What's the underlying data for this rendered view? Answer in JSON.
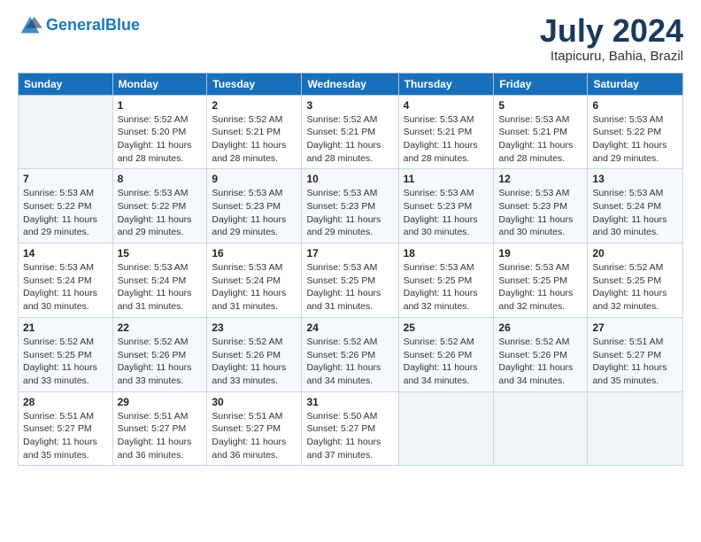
{
  "header": {
    "logo_line1": "General",
    "logo_line2": "Blue",
    "month": "July 2024",
    "location": "Itapicuru, Bahia, Brazil"
  },
  "weekdays": [
    "Sunday",
    "Monday",
    "Tuesday",
    "Wednesday",
    "Thursday",
    "Friday",
    "Saturday"
  ],
  "weeks": [
    [
      {
        "day": "",
        "info": ""
      },
      {
        "day": "1",
        "info": "Sunrise: 5:52 AM\nSunset: 5:20 PM\nDaylight: 11 hours\nand 28 minutes."
      },
      {
        "day": "2",
        "info": "Sunrise: 5:52 AM\nSunset: 5:21 PM\nDaylight: 11 hours\nand 28 minutes."
      },
      {
        "day": "3",
        "info": "Sunrise: 5:52 AM\nSunset: 5:21 PM\nDaylight: 11 hours\nand 28 minutes."
      },
      {
        "day": "4",
        "info": "Sunrise: 5:53 AM\nSunset: 5:21 PM\nDaylight: 11 hours\nand 28 minutes."
      },
      {
        "day": "5",
        "info": "Sunrise: 5:53 AM\nSunset: 5:21 PM\nDaylight: 11 hours\nand 28 minutes."
      },
      {
        "day": "6",
        "info": "Sunrise: 5:53 AM\nSunset: 5:22 PM\nDaylight: 11 hours\nand 29 minutes."
      }
    ],
    [
      {
        "day": "7",
        "info": "Sunrise: 5:53 AM\nSunset: 5:22 PM\nDaylight: 11 hours\nand 29 minutes."
      },
      {
        "day": "8",
        "info": "Sunrise: 5:53 AM\nSunset: 5:22 PM\nDaylight: 11 hours\nand 29 minutes."
      },
      {
        "day": "9",
        "info": "Sunrise: 5:53 AM\nSunset: 5:23 PM\nDaylight: 11 hours\nand 29 minutes."
      },
      {
        "day": "10",
        "info": "Sunrise: 5:53 AM\nSunset: 5:23 PM\nDaylight: 11 hours\nand 29 minutes."
      },
      {
        "day": "11",
        "info": "Sunrise: 5:53 AM\nSunset: 5:23 PM\nDaylight: 11 hours\nand 30 minutes."
      },
      {
        "day": "12",
        "info": "Sunrise: 5:53 AM\nSunset: 5:23 PM\nDaylight: 11 hours\nand 30 minutes."
      },
      {
        "day": "13",
        "info": "Sunrise: 5:53 AM\nSunset: 5:24 PM\nDaylight: 11 hours\nand 30 minutes."
      }
    ],
    [
      {
        "day": "14",
        "info": "Sunrise: 5:53 AM\nSunset: 5:24 PM\nDaylight: 11 hours\nand 30 minutes."
      },
      {
        "day": "15",
        "info": "Sunrise: 5:53 AM\nSunset: 5:24 PM\nDaylight: 11 hours\nand 31 minutes."
      },
      {
        "day": "16",
        "info": "Sunrise: 5:53 AM\nSunset: 5:24 PM\nDaylight: 11 hours\nand 31 minutes."
      },
      {
        "day": "17",
        "info": "Sunrise: 5:53 AM\nSunset: 5:25 PM\nDaylight: 11 hours\nand 31 minutes."
      },
      {
        "day": "18",
        "info": "Sunrise: 5:53 AM\nSunset: 5:25 PM\nDaylight: 11 hours\nand 32 minutes."
      },
      {
        "day": "19",
        "info": "Sunrise: 5:53 AM\nSunset: 5:25 PM\nDaylight: 11 hours\nand 32 minutes."
      },
      {
        "day": "20",
        "info": "Sunrise: 5:52 AM\nSunset: 5:25 PM\nDaylight: 11 hours\nand 32 minutes."
      }
    ],
    [
      {
        "day": "21",
        "info": "Sunrise: 5:52 AM\nSunset: 5:25 PM\nDaylight: 11 hours\nand 33 minutes."
      },
      {
        "day": "22",
        "info": "Sunrise: 5:52 AM\nSunset: 5:26 PM\nDaylight: 11 hours\nand 33 minutes."
      },
      {
        "day": "23",
        "info": "Sunrise: 5:52 AM\nSunset: 5:26 PM\nDaylight: 11 hours\nand 33 minutes."
      },
      {
        "day": "24",
        "info": "Sunrise: 5:52 AM\nSunset: 5:26 PM\nDaylight: 11 hours\nand 34 minutes."
      },
      {
        "day": "25",
        "info": "Sunrise: 5:52 AM\nSunset: 5:26 PM\nDaylight: 11 hours\nand 34 minutes."
      },
      {
        "day": "26",
        "info": "Sunrise: 5:52 AM\nSunset: 5:26 PM\nDaylight: 11 hours\nand 34 minutes."
      },
      {
        "day": "27",
        "info": "Sunrise: 5:51 AM\nSunset: 5:27 PM\nDaylight: 11 hours\nand 35 minutes."
      }
    ],
    [
      {
        "day": "28",
        "info": "Sunrise: 5:51 AM\nSunset: 5:27 PM\nDaylight: 11 hours\nand 35 minutes."
      },
      {
        "day": "29",
        "info": "Sunrise: 5:51 AM\nSunset: 5:27 PM\nDaylight: 11 hours\nand 36 minutes."
      },
      {
        "day": "30",
        "info": "Sunrise: 5:51 AM\nSunset: 5:27 PM\nDaylight: 11 hours\nand 36 minutes."
      },
      {
        "day": "31",
        "info": "Sunrise: 5:50 AM\nSunset: 5:27 PM\nDaylight: 11 hours\nand 37 minutes."
      },
      {
        "day": "",
        "info": ""
      },
      {
        "day": "",
        "info": ""
      },
      {
        "day": "",
        "info": ""
      }
    ]
  ]
}
